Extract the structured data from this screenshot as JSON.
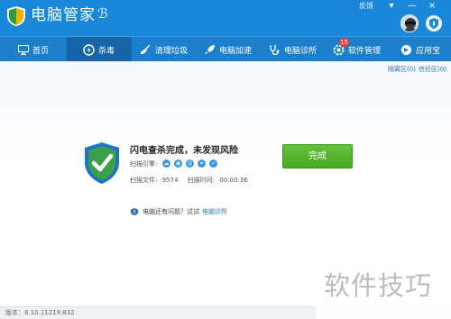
{
  "titlebar": {
    "app_title": "电脑管家",
    "feedback": "反馈",
    "menu_icon": "menu-icon",
    "minimize": "—",
    "close": "×"
  },
  "nav": {
    "items": [
      {
        "label": "首页",
        "icon": "monitor-icon"
      },
      {
        "label": "杀毒",
        "icon": "virus-scan-icon"
      },
      {
        "label": "清理垃圾",
        "icon": "broom-icon"
      },
      {
        "label": "电脑加速",
        "icon": "rocket-icon"
      },
      {
        "label": "电脑诊所",
        "icon": "stethoscope-icon"
      },
      {
        "label": "软件管理",
        "icon": "software-icon"
      },
      {
        "label": "应用宝",
        "icon": "app-store-icon"
      }
    ],
    "active_index": 1,
    "software_badge": "15"
  },
  "toolbar": {
    "quarantine": "隔离区(0)",
    "trust": "信任区(0)"
  },
  "result": {
    "title": "闪电查杀完成，未发现风险",
    "engines_label": "扫描引擎:",
    "files_label": "扫描文件:",
    "files_value": "9574",
    "time_label": "扫描时间:",
    "time_value": "00:00:36",
    "done_button": "完成"
  },
  "hint": {
    "text": "电脑还有问题？试试",
    "link": "电脑诊所"
  },
  "status": {
    "version": "版本：8.10.11219.832"
  },
  "watermark": {
    "text": "软件技巧"
  },
  "colors": {
    "brand_blue": "#1a87d8",
    "nav_active": "#1565a8",
    "done_green": "#4cae25",
    "link_blue": "#2d74b6",
    "badge_red": "#e83a2f"
  }
}
